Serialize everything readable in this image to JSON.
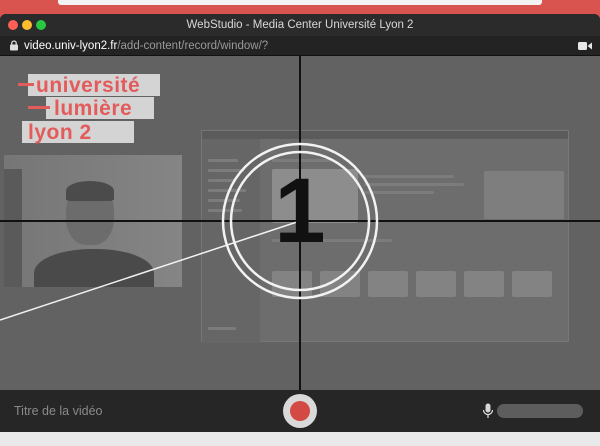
{
  "window": {
    "title": "WebStudio - Media Center Université Lyon 2"
  },
  "address_bar": {
    "host": "video.univ-lyon2.fr",
    "path": "/add-content/record/window/?"
  },
  "logo": {
    "lines": [
      "université",
      "lumière",
      "lyon 2"
    ],
    "color": "#e35b5b"
  },
  "countdown": {
    "number": "1"
  },
  "recording_bar": {
    "title_placeholder": "Titre de la vidéo",
    "record_color": "#d24a43",
    "icons": [
      "record-icon",
      "microphone-icon"
    ]
  },
  "colors": {
    "accent": "#d9534f",
    "overlay": "#626262",
    "toolbar": "#262626"
  }
}
